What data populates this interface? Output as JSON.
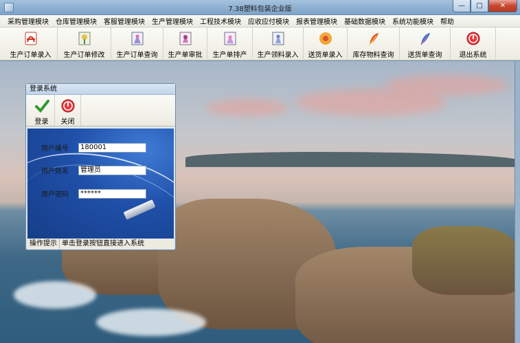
{
  "window": {
    "title": "7.38塑料包装企业版"
  },
  "menu": [
    "采购管理模块",
    "仓库管理模块",
    "客服管理模块",
    "生产管理模块",
    "工程技术模块",
    "应收应付模块",
    "报表管理模块",
    "基础数据模块",
    "系统功能模块",
    "帮助"
  ],
  "toolbar": [
    {
      "label": "生产订单录入",
      "icon": "pdf-icon"
    },
    {
      "label": "生产订单修改",
      "icon": "flower-icon"
    },
    {
      "label": "生产订单查询",
      "icon": "flower-icon"
    },
    {
      "label": "生产单审批",
      "icon": "flower-icon"
    },
    {
      "label": "生产单排产",
      "icon": "flower-icon"
    },
    {
      "label": "生产领料录入",
      "icon": "flower-icon"
    },
    {
      "label": "送货单录入",
      "icon": "sunflower-icon"
    },
    {
      "label": "库存物料查询",
      "icon": "feather-icon"
    },
    {
      "label": "送货单查询",
      "icon": "feather-icon"
    },
    {
      "label": "退出系统",
      "icon": "exit-icon"
    }
  ],
  "dialog": {
    "title": "登录系统",
    "login_label": "登录",
    "close_label": "关闭",
    "user_id_label": "用户编号",
    "user_id_value": "180001",
    "user_name_label": "用户姓名",
    "user_name_value": "管理员",
    "password_label": "用户密码",
    "password_value": "******",
    "status_label": "操作提示",
    "status_text": "单击登录按钮直接进入系统"
  },
  "colors": {
    "accent": "#1f4fa8",
    "close": "#c9452d"
  }
}
